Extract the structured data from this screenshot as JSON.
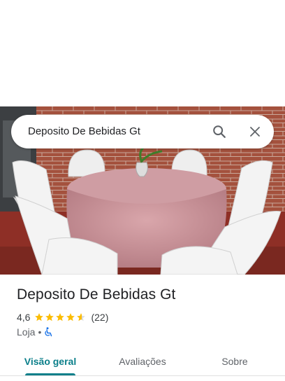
{
  "search": {
    "query": "Deposito De Bebidas Gt",
    "search_icon": "search-icon",
    "close_icon": "close-icon"
  },
  "place": {
    "name": "Deposito De Bebidas Gt",
    "rating": "4,6",
    "stars_value": 4.6,
    "review_count": "(22)",
    "category": "Loja",
    "separator": "•",
    "accessibility_icon": "wheelchair-icon"
  },
  "tabs": [
    {
      "label": "Visão geral",
      "active": true
    },
    {
      "label": "Avaliações",
      "active": false
    },
    {
      "label": "Sobre",
      "active": false
    }
  ],
  "colors": {
    "accent": "#0b7f8a",
    "star": "#fbbc04",
    "accessibility": "#1a73e8"
  }
}
